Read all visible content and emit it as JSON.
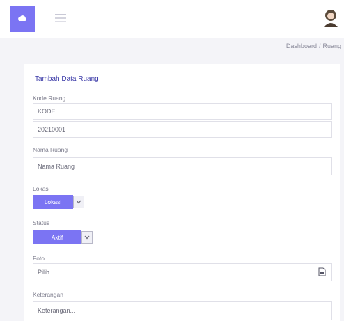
{
  "header": {
    "logo_icon": "cloud-icon",
    "menu_icon": "hamburger-menu-icon",
    "avatar_icon": "user-avatar-icon"
  },
  "breadcrumb": {
    "items": [
      "Dashboard",
      "Ruang"
    ],
    "separator": "/"
  },
  "form": {
    "title": "Tambah Data Ruang",
    "kode_label": "Kode Ruang",
    "kode_value": "KODE",
    "kode_value2": "20210001",
    "nama_label": "Nama Ruang",
    "nama_value": "Nama Ruang",
    "lokasi_label": "Lokasi",
    "lokasi_value": "Lokasi",
    "status_label": "Status",
    "status_value": "Aktif",
    "foto_label": "Foto",
    "foto_placeholder": "Pilih...",
    "keterangan_label": "Keterangan",
    "keterangan_placeholder": "Keterangan..."
  },
  "colors": {
    "accent": "#7b74f3",
    "background": "#f4f4f8"
  }
}
